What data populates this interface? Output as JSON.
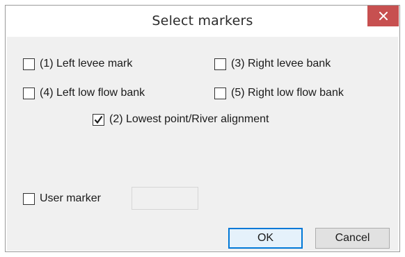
{
  "dialog": {
    "title": "Select markers",
    "close_label": "×",
    "accent_close": "#c75050",
    "default_button_border": "#0078d7"
  },
  "markers": [
    {
      "label": "(1) Left levee mark",
      "checked": false
    },
    {
      "label": "(3) Right levee bank",
      "checked": false
    },
    {
      "label": "(4) Left low flow bank",
      "checked": false
    },
    {
      "label": "(5) Right low flow bank",
      "checked": false
    },
    {
      "label": "(2) Lowest point/River alignment",
      "checked": true
    }
  ],
  "user_marker": {
    "label": "User marker",
    "checked": false,
    "value": "",
    "enabled": false
  },
  "buttons": {
    "ok": "OK",
    "cancel": "Cancel"
  }
}
